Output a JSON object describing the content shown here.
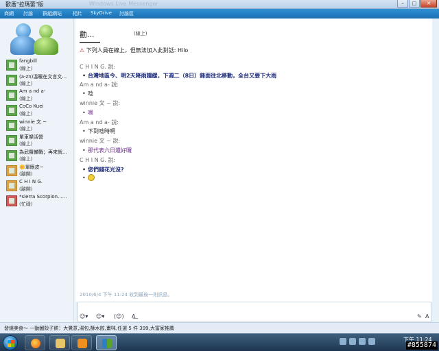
{
  "window": {
    "title": "歡厝\"拉瑪蕾\"版",
    "ghost_title": "Windows Live Messenger",
    "buttons": {
      "minimize": "–",
      "maximize": "□",
      "close": "✕"
    }
  },
  "menu": [
    "商網",
    "討論",
    "群組網站",
    "相片",
    "SkyDrive",
    "討論區"
  ],
  "contacts": [
    {
      "name": "fangbill",
      "status": "(線上)",
      "state": "online"
    },
    {
      "name": "(a-zn)溫暖在文言文...",
      "status": "(線上)",
      "state": "online"
    },
    {
      "name": "Am a nd a-",
      "status": "(線上)",
      "state": "online"
    },
    {
      "name": "CoCo Kuei",
      "status": "(線上)",
      "state": "online"
    },
    {
      "name": "winnie 文 ~",
      "status": "(線上)",
      "state": "online"
    },
    {
      "name": "單車樂活營",
      "status": "(線上)",
      "state": "online"
    },
    {
      "name": "為武羅備戰；再來就...",
      "status": "(線上)",
      "state": "online"
    },
    {
      "name": "🌼單眼皮~",
      "status": "(離開)",
      "state": "away"
    },
    {
      "name": "C H I N G.",
      "status": "(離開)",
      "state": "away"
    },
    {
      "name": "*sierra Scorpion......",
      "status": "(忙碌)",
      "state": "busy"
    }
  ],
  "chat": {
    "header_name": "勸...",
    "header_status": "(線上)",
    "notice": "下列人員在線上，但無法加入此對話: Hilo",
    "messages": [
      {
        "speaker": "C H I N G. 說:",
        "text": "台灣地區今、明2天降雨趨緩，下週二（8日）鋒面往北移動，全台又要下大雨",
        "style": "c-blue"
      },
      {
        "speaker": "Am a nd a- 說:",
        "text": "唸",
        "style": "c-dark"
      },
      {
        "speaker": "winnie 文 ~ 說:",
        "text": "嗯",
        "style": "c-purple"
      },
      {
        "speaker": "Am a nd a- 說:",
        "text": "下到唸時啊",
        "style": "c-dark"
      },
      {
        "speaker": "winnie 文 ~ 說:",
        "text": "那代表六日還好囉",
        "style": "c-purple"
      },
      {
        "speaker": "C H I N G. 說:",
        "text": "您們錢花光沒?",
        "style": "c-blue"
      }
    ],
    "last_message_time": "2010/6/4 下午 11:24 收到最後一則訊息。"
  },
  "toolbar": {
    "emoticon": "☺▾",
    "wink": "☺▾",
    "nudge": "(☺)",
    "font": "A͟",
    "draw": "✎",
    "text_a": "A"
  },
  "ad": {
    "text": "發燒美食～ 一動圖殼子餅：大覺意,湯包,酥水餃,畫咪,任選 5 件 399,大富家推薦"
  },
  "taskbar": {
    "clock": "下午 11:24",
    "watermark": "#855874"
  },
  "colors": {
    "online": "#5aa64a",
    "away": "#d9a24a",
    "busy": "#d25a5a",
    "menubar": "#1a6fb5"
  }
}
